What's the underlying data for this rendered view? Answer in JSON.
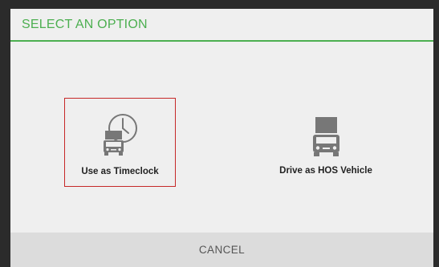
{
  "dialog": {
    "title": "SELECT AN OPTION",
    "cancel_label": "CANCEL",
    "accent_color": "#4caf50",
    "options": [
      {
        "label": "Use as Timeclock",
        "icon": "timeclock-truck-icon",
        "selected": true,
        "selected_border_color": "#c62828"
      },
      {
        "label": "Drive as HOS Vehicle",
        "icon": "truck-icon",
        "selected": false
      }
    ]
  }
}
